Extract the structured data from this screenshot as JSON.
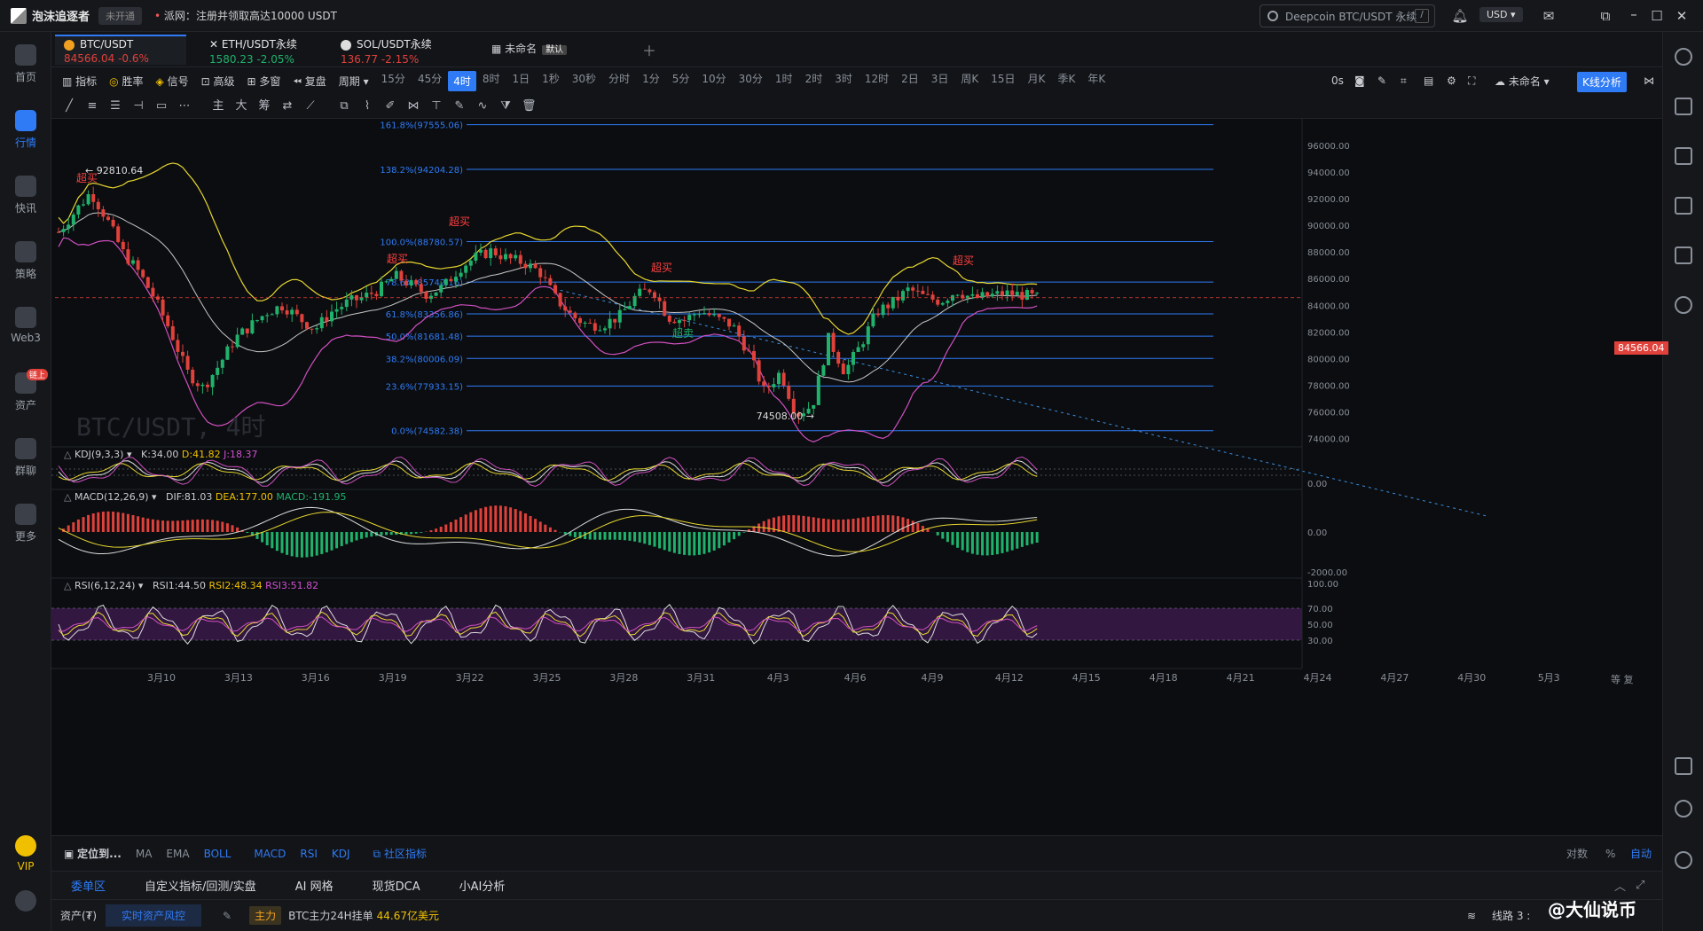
{
  "app": {
    "name": "泡沫追逐者",
    "status_pill": "未开通",
    "news_prefix": "派网：",
    "news": "注册并领取高达10000 USDT"
  },
  "search": {
    "placeholder": "Deepcoin BTC/USDT 永续",
    "shortcut": "/"
  },
  "currency": "USD",
  "sidebar": {
    "items": [
      {
        "label": "首页",
        "icon": "home-icon"
      },
      {
        "label": "行情",
        "icon": "chart-icon",
        "active": true
      },
      {
        "label": "快讯",
        "icon": "news-icon"
      },
      {
        "label": "策略",
        "icon": "robot-icon"
      },
      {
        "label": "Web3",
        "icon": "web3-icon"
      },
      {
        "label": "资产",
        "icon": "wallet-icon",
        "badge": "链上"
      },
      {
        "label": "群聊",
        "icon": "chat-icon"
      },
      {
        "label": "更多",
        "icon": "grid-icon"
      }
    ],
    "vip": "VIP"
  },
  "symbol_tabs": [
    {
      "name": "BTC/USDT",
      "price": "84566.04",
      "change": "-0.6%"
    },
    {
      "name": "ETH/USDT永续",
      "price": "1580.23",
      "change": "-2.05%"
    },
    {
      "name": "SOL/USDT永续",
      "price": "136.77",
      "change": "-2.15%"
    }
  ],
  "layout_tab": {
    "name": "未命名",
    "badge": "默认"
  },
  "toolbar": {
    "items": [
      "指标",
      "胜率",
      "信号",
      "高级",
      "多窗",
      "复盘",
      "周期"
    ],
    "periods": [
      "15分",
      "45分",
      "4时",
      "8时",
      "1日",
      "1秒",
      "30秒",
      "分时",
      "1分",
      "5分",
      "10分",
      "30分",
      "1时",
      "2时",
      "3时",
      "12时",
      "2日",
      "3日",
      "周K",
      "15日",
      "月K",
      "季K",
      "年K"
    ],
    "selected_period": "4时",
    "timer": "0s",
    "layout_name": "未命名",
    "kline_analysis": "K线分析"
  },
  "drawing_tools": {
    "main": "主",
    "big": "大",
    "chips": "筹"
  },
  "chart_data": {
    "type": "candlestick",
    "symbol_watermark": "BTC/USDT, 4时",
    "last_price": "84566.04",
    "high_label": "92810.64",
    "low_label": "74508.00",
    "overbought_labels": [
      "超买",
      "超买",
      "超买",
      "超买",
      "超买"
    ],
    "oversold_label": "超卖",
    "price_axis": [
      "96000.00",
      "94000.00",
      "92000.00",
      "90000.00",
      "88000.00",
      "86000.00",
      "84000.00",
      "82000.00",
      "80000.00",
      "78000.00",
      "76000.00",
      "74000.00"
    ],
    "ylim": [
      73500,
      98000
    ],
    "fib_levels": [
      {
        "label": "161.8%(97555.06)",
        "price": 97555.06
      },
      {
        "label": "138.2%(94204.28)",
        "price": 94204.28
      },
      {
        "label": "100.0%(88780.57)",
        "price": 88780.57
      },
      {
        "label": "78.6%(85742.16)",
        "price": 85742.16
      },
      {
        "label": "61.8%(83356.86)",
        "price": 83356.86
      },
      {
        "label": "50.0%(81681.48)",
        "price": 81681.48
      },
      {
        "label": "38.2%(80006.09)",
        "price": 80006.09
      },
      {
        "label": "23.6%(77933.15)",
        "price": 77933.15
      },
      {
        "label": "0.0%(74582.38)",
        "price": 74582.38
      }
    ],
    "x_labels": [
      "3月10",
      "3月13",
      "3月16",
      "3月19",
      "3月22",
      "3月25",
      "3月28",
      "3月31",
      "4月3",
      "4月6",
      "4月9",
      "4月12",
      "4月15",
      "4月18",
      "4月21",
      "4月24",
      "4月27",
      "4月30",
      "5月3"
    ],
    "price_path": [
      [
        0,
        89500
      ],
      [
        1,
        91000
      ],
      [
        2,
        92500
      ],
      [
        3,
        90500
      ],
      [
        4,
        88000
      ],
      [
        5,
        86500
      ],
      [
        6,
        84500
      ],
      [
        7,
        82000
      ],
      [
        8,
        79000
      ],
      [
        9,
        77800
      ],
      [
        10,
        79500
      ],
      [
        11,
        81500
      ],
      [
        12,
        82500
      ],
      [
        13,
        83500
      ],
      [
        14,
        84000
      ],
      [
        15,
        83000
      ],
      [
        16,
        82200
      ],
      [
        17,
        83500
      ],
      [
        18,
        84200
      ],
      [
        19,
        84600
      ],
      [
        20,
        85200
      ],
      [
        21,
        86200
      ],
      [
        22,
        85500
      ],
      [
        23,
        84800
      ],
      [
        24,
        85400
      ],
      [
        25,
        86800
      ],
      [
        26,
        87600
      ],
      [
        27,
        88100
      ],
      [
        28,
        87500
      ],
      [
        29,
        87200
      ],
      [
        30,
        86500
      ],
      [
        31,
        84500
      ],
      [
        32,
        83200
      ],
      [
        33,
        82500
      ],
      [
        34,
        82600
      ],
      [
        35,
        83200
      ],
      [
        36,
        84700
      ],
      [
        37,
        85300
      ],
      [
        38,
        83100
      ],
      [
        39,
        82900
      ],
      [
        40,
        83600
      ],
      [
        41,
        83000
      ],
      [
        42,
        82500
      ],
      [
        43,
        80500
      ],
      [
        44,
        77500
      ],
      [
        45,
        79000
      ],
      [
        46,
        75800
      ],
      [
        47,
        76500
      ],
      [
        48,
        81500
      ],
      [
        49,
        79000
      ],
      [
        50,
        81000
      ],
      [
        51,
        83500
      ],
      [
        52,
        84200
      ],
      [
        53,
        85200
      ],
      [
        54,
        84600
      ],
      [
        55,
        84300
      ],
      [
        56,
        85100
      ],
      [
        57,
        84500
      ],
      [
        58,
        84700
      ],
      [
        59,
        84900
      ],
      [
        60,
        84800
      ],
      [
        61,
        84566
      ]
    ],
    "indicators": {
      "kdj": {
        "params": "KDJ(9,3,3)",
        "k": "K:34.00",
        "d": "D:41.82",
        "j": "J:18.37",
        "axis": "0.00"
      },
      "macd": {
        "params": "MACD(12,26,9)",
        "dif": "DIF:81.03",
        "dea": "DEA:177.00",
        "macd": "MACD:-191.95",
        "axis": [
          "0.00",
          "-2000.00"
        ]
      },
      "rsi": {
        "params": "RSI(6,12,24)",
        "rsi1": "RSI1:44.50",
        "rsi2": "RSI2:48.34",
        "rsi3": "RSI3:51.82",
        "axis": [
          "100.00",
          "70.00",
          "50.00",
          "30.00"
        ]
      }
    },
    "colors": {
      "up": "#20b26c",
      "down": "#e0413b",
      "fib": "#2f7bf5",
      "boll_upper": "#e8d730",
      "boll_mid": "#c8c8c8",
      "boll_lower": "#d050c0"
    }
  },
  "bottom_bar": {
    "locate": "定位到...",
    "indicators": [
      "MA",
      "EMA",
      "BOLL",
      "MACD",
      "RSI",
      "KDJ"
    ],
    "community": "社区指标",
    "scale": [
      "对数",
      "%",
      "自动"
    ]
  },
  "panel_tabs": [
    "委单区",
    "自定义指标/回测/实盘",
    "AI 网格",
    "现货DCA",
    "小AI分析"
  ],
  "status": {
    "asset": "资产(₮)",
    "risk": "实时资产风控",
    "main": "主力",
    "ticker": "BTC主力24H挂单",
    "ticker_value": "44.67亿美元",
    "line": "线路 3 :"
  },
  "watermark": "@大仙说币"
}
